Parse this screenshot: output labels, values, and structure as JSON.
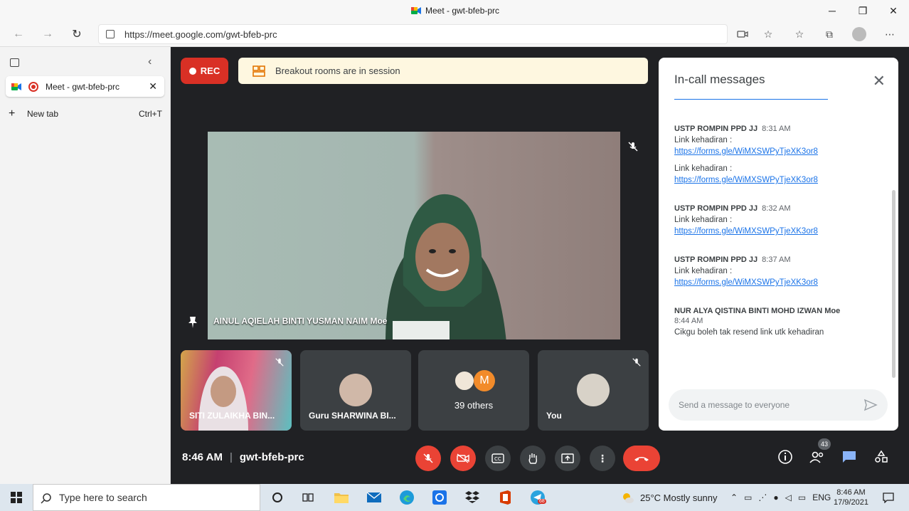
{
  "window": {
    "title": "Meet - gwt-bfeb-prc"
  },
  "browser": {
    "url": "https://meet.google.com/gwt-bfeb-prc"
  },
  "sidebar": {
    "tab_title": "Meet - gwt-bfeb-prc",
    "new_tab_label": "New tab",
    "new_tab_shortcut": "Ctrl+T"
  },
  "meet": {
    "rec_label": "REC",
    "banner": "Breakout rooms are in session",
    "main_participant": "AINUL AQIELAH BINTI YUSMAN NAIM Moe",
    "tiles": [
      {
        "name": "SITI ZULAIKHA BIN..."
      },
      {
        "name": "Guru SHARWINA BI..."
      },
      {
        "name": "39 others",
        "avatar_letter": "M"
      },
      {
        "name": "You"
      }
    ],
    "clock": "8:46 AM",
    "meeting_code": "gwt-bfeb-prc",
    "participant_count": "43"
  },
  "chat": {
    "title": "In-call messages",
    "messages": [
      {
        "sender": "USTP ROMPIN PPD JJ",
        "time": "8:31 AM",
        "text": "Link kehadiran :",
        "link": "https://forms.gle/WiMXSWPyTjeXK3or8"
      },
      {
        "sender": "",
        "time": "",
        "text": "Link kehadiran :",
        "link": "https://forms.gle/WiMXSWPyTjeXK3or8"
      },
      {
        "sender": "USTP ROMPIN PPD JJ",
        "time": "8:32 AM",
        "text": "Link kehadiran :",
        "link": "https://forms.gle/WiMXSWPyTjeXK3or8"
      },
      {
        "sender": "USTP ROMPIN PPD JJ",
        "time": "8:37 AM",
        "text": "Link kehadiran :",
        "link": "https://forms.gle/WiMXSWPyTjeXK3or8"
      },
      {
        "sender": "NUR ALYA QISTINA BINTI MOHD IZWAN Moe",
        "time": "8:44 AM",
        "text": "Cikgu boleh tak resend link utk kehadiran",
        "link": ""
      }
    ],
    "input_placeholder": "Send a message to everyone"
  },
  "taskbar": {
    "search_placeholder": "Type here to search",
    "weather": "25°C  Mostly sunny",
    "lang": "ENG",
    "time": "8:46 AM",
    "date": "17/9/2021",
    "telegram_badge": "68"
  },
  "colors": {
    "accent_red": "#ea4335",
    "rec_red": "#d93025",
    "meet_bg": "#202124",
    "tile_bg": "#3c4043",
    "link_blue": "#1a73e8",
    "banner_bg": "#fef7e0"
  }
}
